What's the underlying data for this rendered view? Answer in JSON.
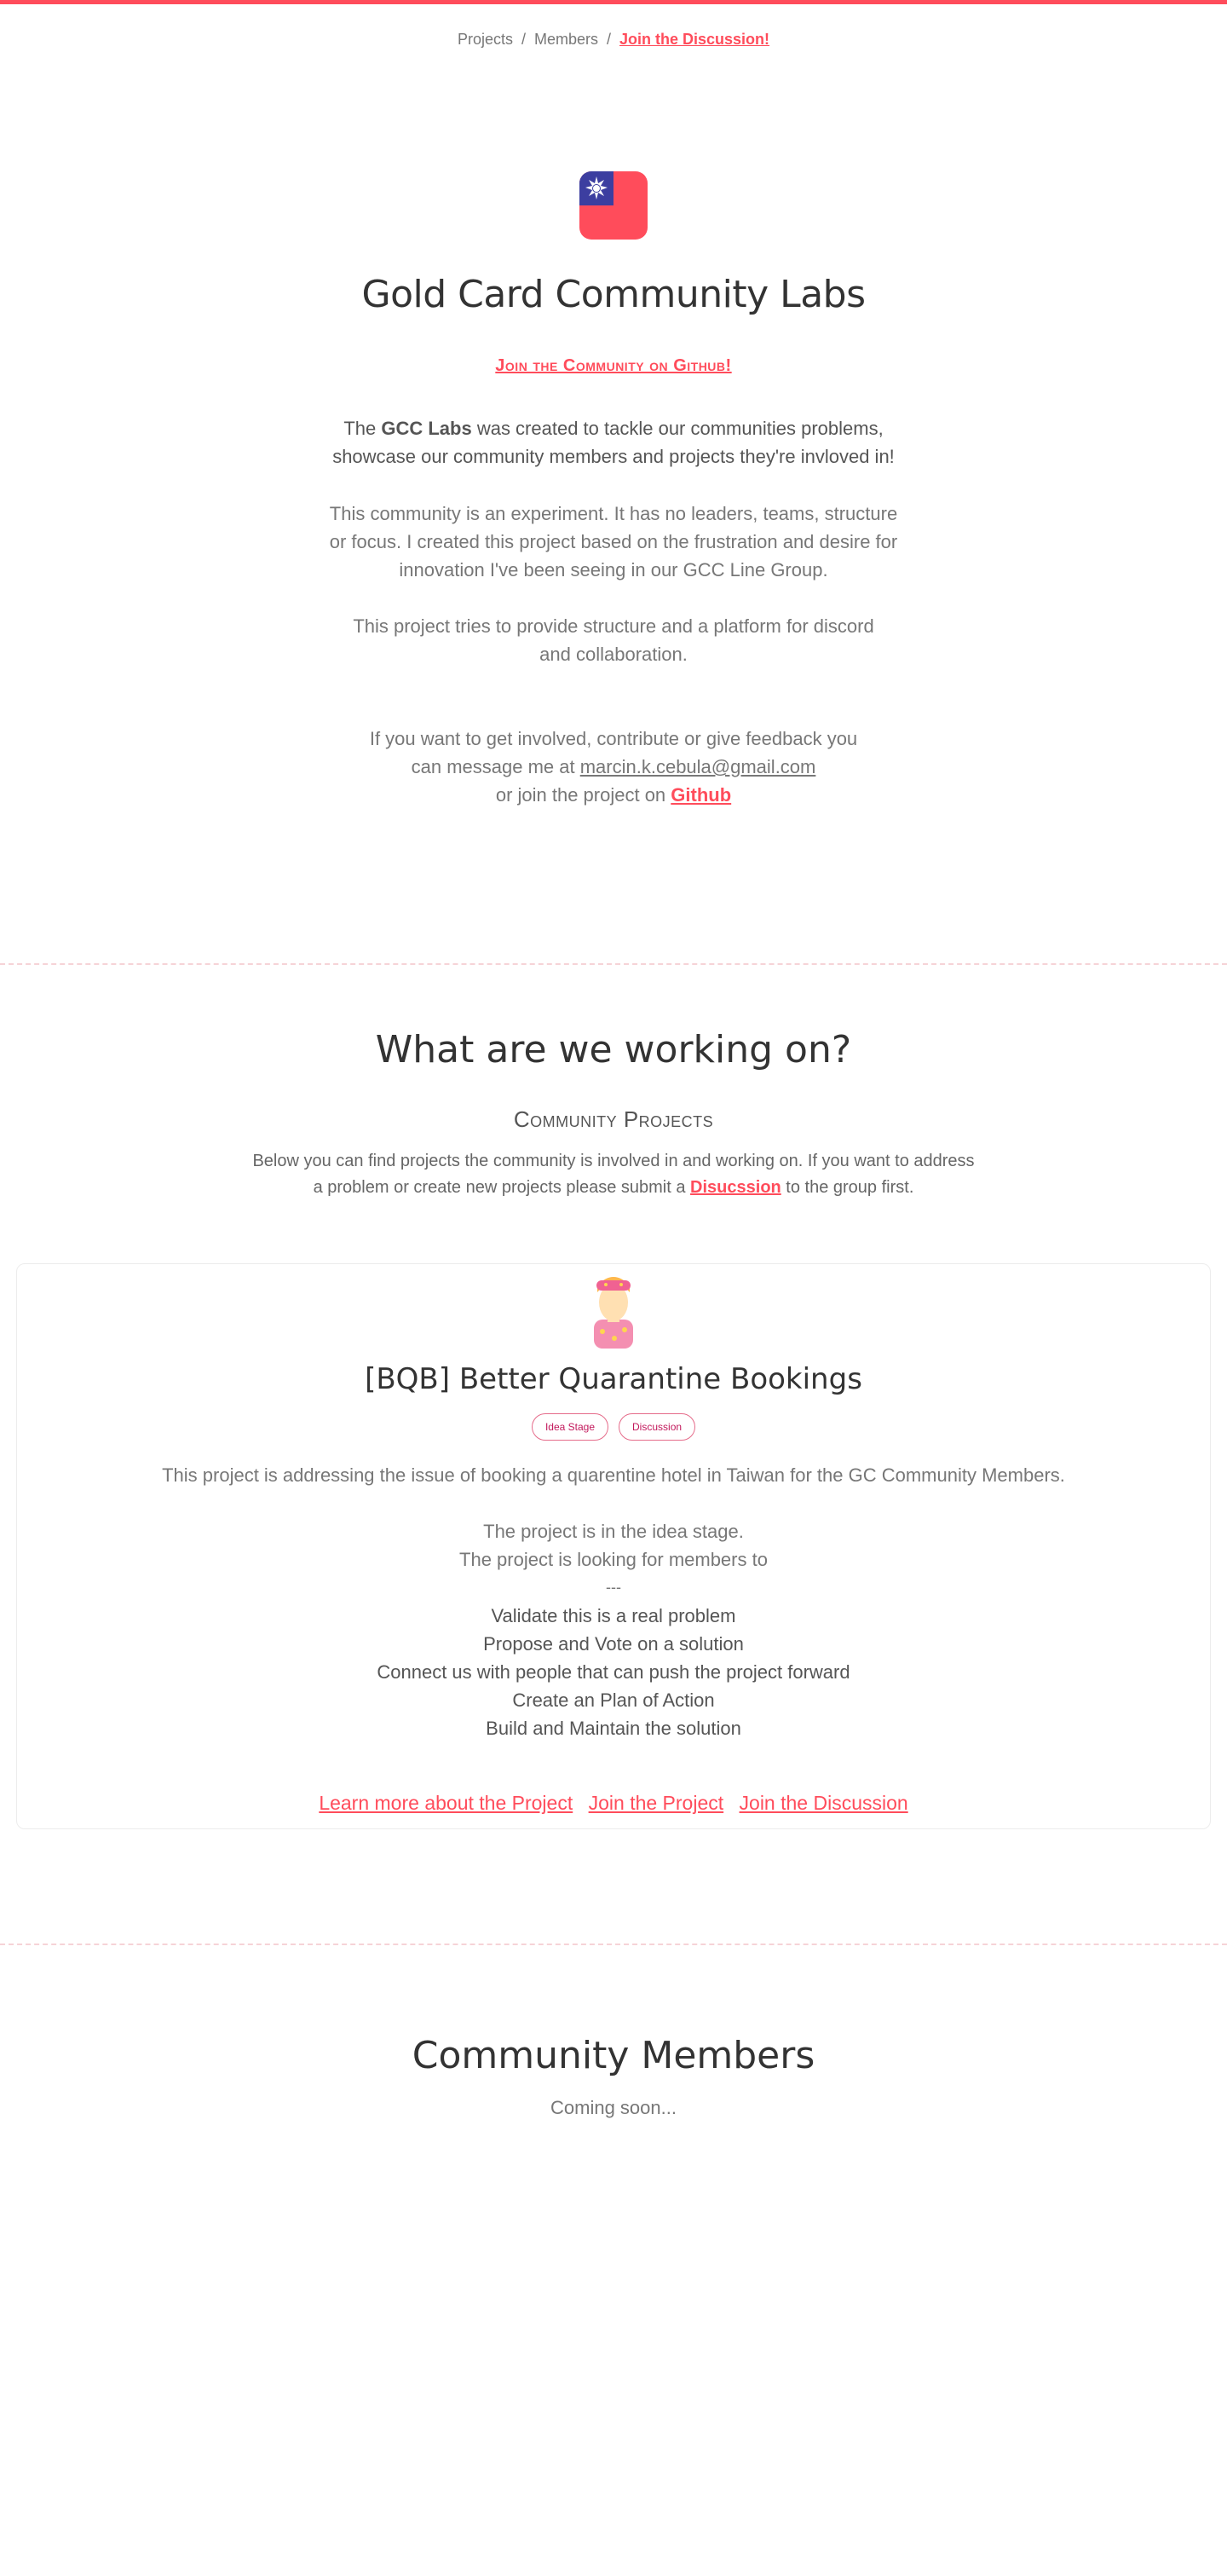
{
  "colors": {
    "accent": "#ff4c5b",
    "flag_blue": "#3c3ea0",
    "badge": "#c2185b"
  },
  "nav": {
    "projects": "Projects",
    "members": "Members",
    "discussion": "Join the Discussion!"
  },
  "header": {
    "flag_icon": "taiwan-flag-icon",
    "title": "Gold Card Community Labs",
    "github_cta": "Join the Community on Github!"
  },
  "about": {
    "intro_pre": "The ",
    "intro_bold": "GCC Labs",
    "intro_post": " was created to tackle our communities problems,",
    "intro_line2": "showcase our community members and projects they're invloved in!",
    "p1_l1": "This community is an experiment. It has no leaders, teams, structure",
    "p1_l2": "or focus. I created this project based on the frustration and desire for",
    "p1_l3": "innovation I've been seeing in our GCC Line Group.",
    "p2_l1": "This project tries to provide structure and a platform for discord",
    "p2_l2": "and collaboration.",
    "p3_l1": "If you want to get involved, contribute or give feedback you",
    "p3_l2_pre": "can message me at ",
    "email": "marcin.k.cebula@gmail.com",
    "p3_l3_pre": "or join the project on ",
    "github": "Github"
  },
  "projects_section": {
    "title": "What are we working on?",
    "subtitle": "Community Projects",
    "desc_l1": "Below you can find projects the community is involved in and working on. If you want to address",
    "desc_l2_pre": "a problem or create new projects please submit a ",
    "desc_link": "Disucssion",
    "desc_l2_post": " to the group first."
  },
  "project": {
    "title": "[BQB] Better Quarantine Bookings",
    "badges": [
      "Idea Stage",
      "Discussion"
    ],
    "description": "This project is addressing the issue of booking a quarentine hotel in Taiwan for the GC Community Members.",
    "stage": "The project is in the idea stage.",
    "looking": "The project is looking for members to",
    "divider": "---",
    "tasks": [
      "Validate this is a real problem",
      "Propose and Vote on a solution",
      "Connect us with people that can push the project forward",
      "Create an Plan of Action",
      "Build and Maintain the solution"
    ],
    "links": {
      "learn": "Learn more about the Project",
      "join": "Join the Project",
      "discussion": "Join the Discussion"
    }
  },
  "members": {
    "title": "Community Members",
    "status": "Coming soon..."
  }
}
